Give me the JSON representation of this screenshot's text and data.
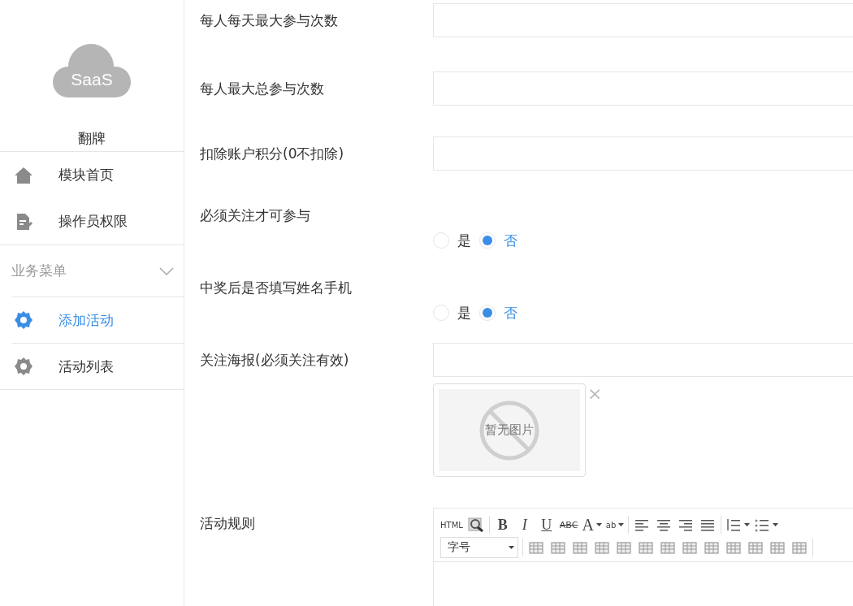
{
  "sidebar": {
    "logo_text": "SaaS",
    "title": "翻牌",
    "items": [
      {
        "kind": "house",
        "label": "模块首页",
        "selected": false
      },
      {
        "kind": "document",
        "label": "操作员权限",
        "selected": false
      }
    ],
    "section": {
      "label": "业务菜单",
      "expanded": true,
      "items": [
        {
          "kind": "gear",
          "label": "添加活动",
          "selected": true
        },
        {
          "kind": "gear",
          "label": "活动列表",
          "selected": false
        }
      ]
    }
  },
  "form": {
    "fields": [
      {
        "kind": "text",
        "label": "每人每天最大参与次数"
      },
      {
        "kind": "text",
        "label": "每人最大总参与次数"
      },
      {
        "kind": "text",
        "label": "扣除账户积分(0不扣除)"
      },
      {
        "kind": "radio",
        "label": "必须关注才可参与",
        "options": [
          {
            "label": "是",
            "selected": false
          },
          {
            "label": "否",
            "selected": true
          }
        ]
      },
      {
        "kind": "radio",
        "label": "中奖后是否填写姓名手机",
        "options": [
          {
            "label": "是",
            "selected": false
          },
          {
            "label": "否",
            "selected": true
          }
        ]
      },
      {
        "kind": "image",
        "label": "关注海报(必须关注有效)",
        "placeholder_text": "暂无图片",
        "remove": "×"
      },
      {
        "kind": "editor",
        "label": "活动规则",
        "toolbar_rows": [
          [
            {
              "kind": "html",
              "label": "HTML"
            },
            {
              "kind": "preview"
            },
            {
              "kind": "sep"
            },
            {
              "kind": "bold",
              "label": "B"
            },
            {
              "kind": "italic",
              "label": "I"
            },
            {
              "kind": "underline",
              "label": "U"
            },
            {
              "kind": "strike",
              "label": "ABC"
            },
            {
              "kind": "font-color",
              "label": "A"
            },
            {
              "kind": "highlight",
              "label": "ab"
            },
            {
              "kind": "sep"
            },
            {
              "kind": "align-left"
            },
            {
              "kind": "align-center"
            },
            {
              "kind": "align-right"
            },
            {
              "kind": "justify"
            },
            {
              "kind": "sep"
            },
            {
              "kind": "ordered-list"
            },
            {
              "kind": "bullet-list"
            }
          ],
          [
            {
              "kind": "select",
              "label": "字号"
            },
            {
              "kind": "sep"
            },
            {
              "kind": "table"
            },
            {
              "kind": "table"
            },
            {
              "kind": "table"
            },
            {
              "kind": "table"
            },
            {
              "kind": "table"
            },
            {
              "kind": "table"
            },
            {
              "kind": "table"
            },
            {
              "kind": "table"
            },
            {
              "kind": "table"
            },
            {
              "kind": "table"
            },
            {
              "kind": "table"
            },
            {
              "kind": "table"
            },
            {
              "kind": "table"
            },
            {
              "kind": "sep"
            }
          ]
        ]
      }
    ]
  }
}
